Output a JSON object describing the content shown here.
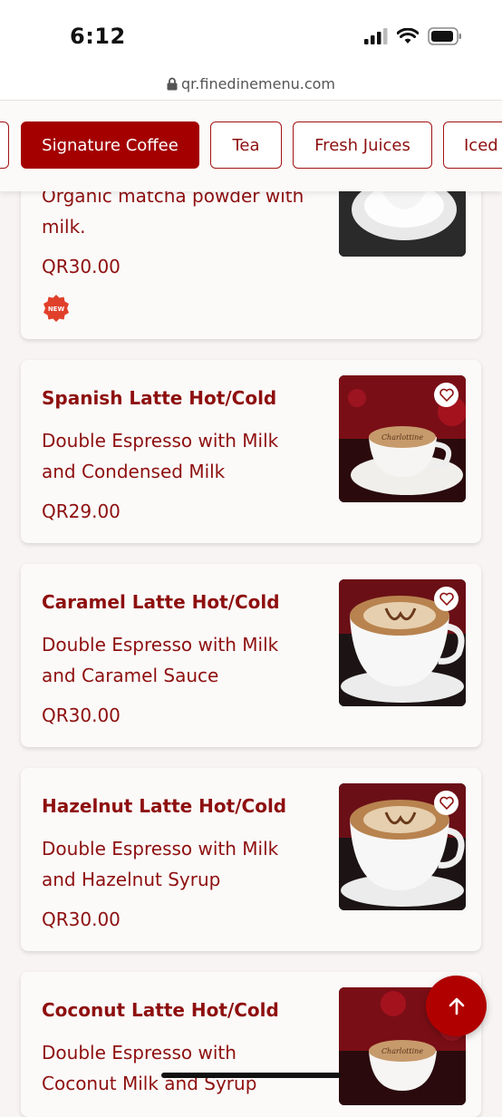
{
  "status_bar": {
    "time": "6:12"
  },
  "browser": {
    "url": "qr.finedinemenu.com"
  },
  "tabs": [
    {
      "label": ""
    },
    {
      "label": "Signature Coffee"
    },
    {
      "label": "Tea"
    },
    {
      "label": "Fresh Juices"
    },
    {
      "label": "Iced"
    }
  ],
  "items": [
    {
      "name": "",
      "description": "Organic matcha powder with milk.",
      "price": "QR30.00",
      "badge": "NEW"
    },
    {
      "name": "Spanish Latte Hot/Cold",
      "description": "Double Espresso with Milk and Condensed Milk",
      "price": "QR29.00"
    },
    {
      "name": "Caramel Latte Hot/Cold",
      "description": "Double Espresso with Milk and Caramel Sauce",
      "price": "QR30.00"
    },
    {
      "name": "Hazelnut Latte Hot/Cold",
      "description": "Double Espresso with Milk and Hazelnut Syrup",
      "price": "QR30.00"
    },
    {
      "name": "Coconut Latte Hot/Cold",
      "description": "Double Espresso with Coconut Milk and Syrup",
      "price": ""
    }
  ],
  "colors": {
    "brand": "#a40000",
    "text": "#8e0f0f",
    "background": "#f7f4f3"
  },
  "icons": {
    "favorite": "heart-icon",
    "scroll_top": "arrow-up-icon",
    "lock": "lock-icon"
  }
}
